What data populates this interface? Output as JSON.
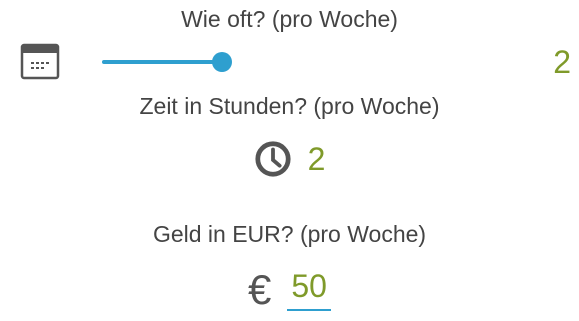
{
  "frequency": {
    "label": "Wie oft? (pro Woche)",
    "value": "2",
    "slider_fraction": 0.8,
    "icon": "calendar-icon"
  },
  "time": {
    "label": "Zeit in Stunden? (pro Woche)",
    "value": "2",
    "icon": "clock-icon"
  },
  "money": {
    "label": "Geld in EUR? (pro Woche)",
    "value": "50",
    "icon": "euro-icon"
  },
  "colors": {
    "accent": "#2e9fcf",
    "value_text": "#7f9a2a",
    "label_text": "#444444"
  }
}
